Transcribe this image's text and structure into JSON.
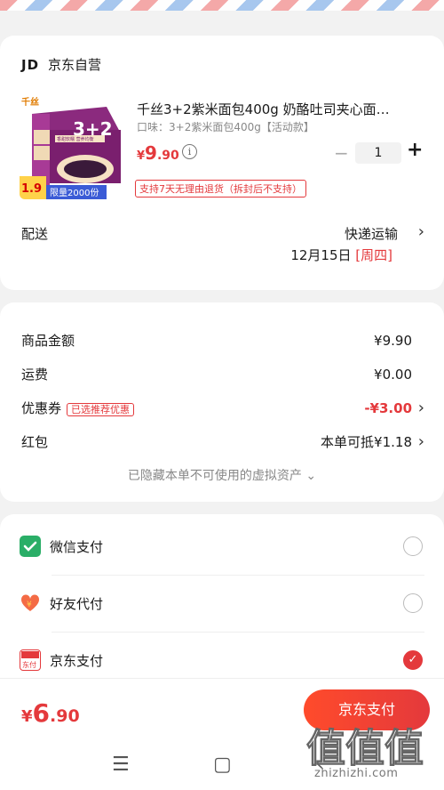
{
  "store": {
    "logo": "JD",
    "name": "京东自营"
  },
  "product": {
    "title": "千丝3+2紫米面包400g 奶酪吐司夹心面…",
    "variant": "口味：3+2紫米面包400g【活动款】",
    "price_currency": "¥",
    "price_int": "9",
    "price_dec": ".90",
    "quantity": "1",
    "minus": "−",
    "plus": "+",
    "return_policy": "支持7天无理由退货（拆封后不支持）",
    "image_text": {
      "brand": "千丝",
      "combo": "3+2",
      "promo_price": "1.9",
      "promo_yuan": "¥",
      "limit": "限量2000份",
      "sub": "香甜软糯 营养均衡"
    }
  },
  "delivery": {
    "label": "配送",
    "method": "快递运输",
    "date": "12月15日",
    "weekday": "[周四]"
  },
  "summary": {
    "rows": [
      {
        "label": "商品金额",
        "value": "¥9.90"
      },
      {
        "label": "运费",
        "value": "¥0.00"
      },
      {
        "label": "优惠券",
        "tag": "已选推荐优惠",
        "value": "-¥3.00"
      },
      {
        "label": "红包",
        "value": "本单可抵¥1.18"
      }
    ],
    "hidden_assets": "已隐藏本单不可使用的虚拟资产 ⌄"
  },
  "payment": {
    "options": [
      {
        "label": "微信支付",
        "icon": "wechat-pay-icon",
        "selected": false
      },
      {
        "label": "好友代付",
        "icon": "friend-pay-icon",
        "selected": false
      },
      {
        "label": "京东支付",
        "icon": "jd-pay-icon",
        "icon_text": "东付",
        "selected": true
      }
    ]
  },
  "bottom": {
    "currency": "¥",
    "total_int": "6",
    "total_dec": ".90",
    "pay_button": "京东支付"
  },
  "watermark": {
    "text": "zhizhizhi.com",
    "glyphs": "值值值"
  },
  "colors": {
    "accent": "#e4393c",
    "wechat": "#2aae67",
    "friend": "#f46b45"
  }
}
